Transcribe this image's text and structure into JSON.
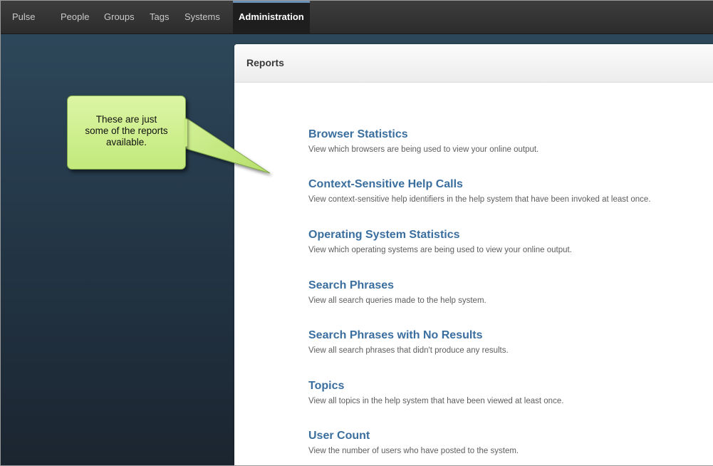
{
  "nav": {
    "items": [
      {
        "label": "Pulse"
      },
      {
        "label": "People"
      },
      {
        "label": "Groups"
      },
      {
        "label": "Tags"
      },
      {
        "label": "Systems"
      },
      {
        "label": "Administration"
      }
    ],
    "active_index": 5
  },
  "panel": {
    "title": "Reports"
  },
  "reports": [
    {
      "title": "Browser Statistics",
      "description": "View which browsers are being used to view your online output."
    },
    {
      "title": "Context-Sensitive Help Calls",
      "description": "View context-sensitive help identifiers in the help system that have been invoked at least once."
    },
    {
      "title": "Operating System Statistics",
      "description": "View which operating systems are being used to view your online output."
    },
    {
      "title": "Search Phrases",
      "description": "View all search queries made to the help system."
    },
    {
      "title": "Search Phrases with No Results",
      "description": "View all search phrases that didn't produce any results."
    },
    {
      "title": "Topics",
      "description": "View all topics in the help system that have been viewed at least once."
    },
    {
      "title": "User Count",
      "description": "View the number of users who have posted to the system."
    }
  ],
  "callout": {
    "lines": [
      "These are just",
      "some of the reports",
      "available."
    ]
  },
  "colors": {
    "link": "#3a6e9f",
    "callout_fill": "#c3e97c",
    "nav_bg": "#2c2c2c",
    "nav_active_accent": "#6c8fb8"
  }
}
